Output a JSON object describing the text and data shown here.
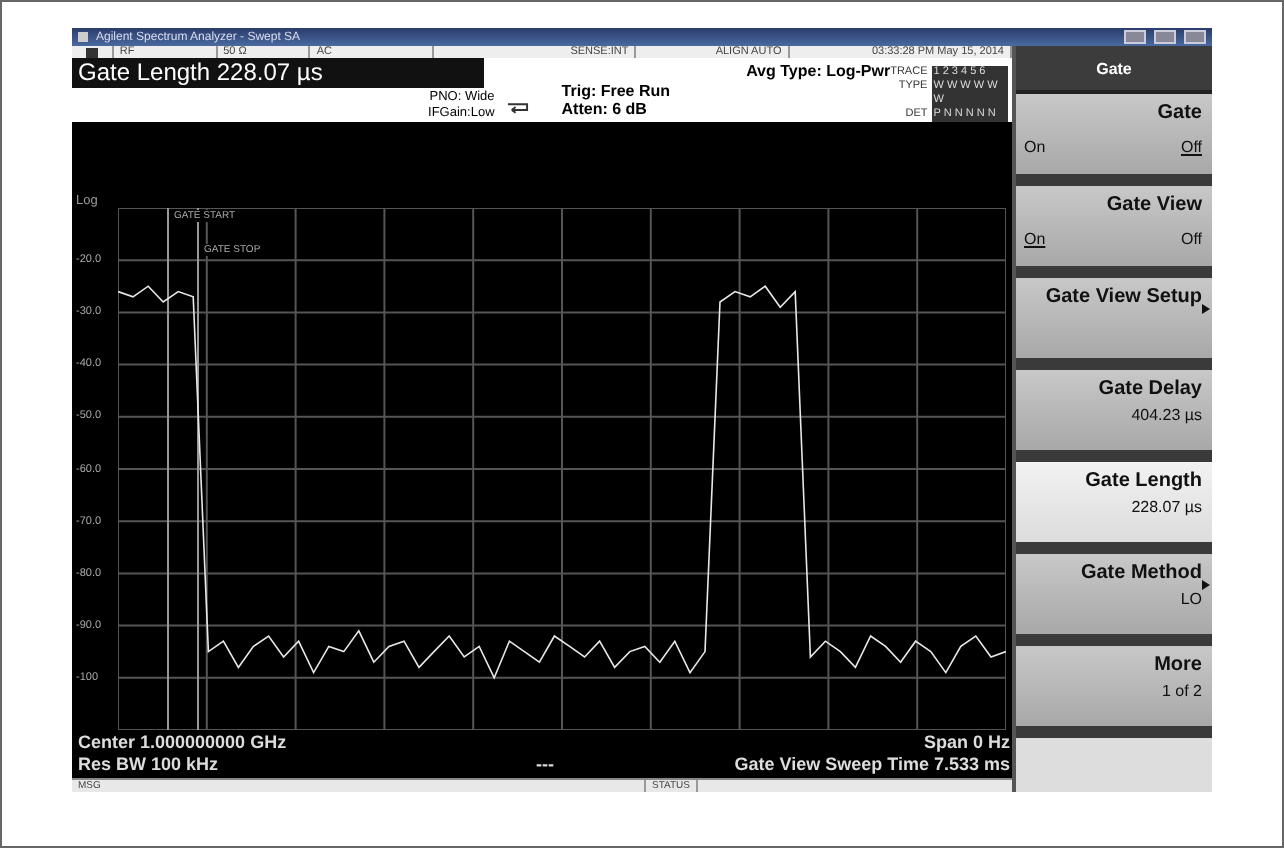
{
  "window": {
    "title": "Agilent Spectrum Analyzer - Swept SA"
  },
  "status_row": [
    "RF",
    "50 Ω",
    "AC",
    "SENSE:INT",
    "ALIGN AUTO",
    "03:33:28 PM May 15, 2014"
  ],
  "active_function": "Gate Length 228.07 µs",
  "settings": {
    "pno": "PNO: Wide",
    "ifgain": "IFGain:Low",
    "trig": "Trig: Free Run",
    "atten": "Atten: 6 dB",
    "avg_type": "Avg Type: Log-Pwr"
  },
  "trace_table": [
    {
      "label": "TRACE",
      "value": "1 2 3 4 5 6"
    },
    {
      "label": "TYPE",
      "value": "W W W W W W"
    },
    {
      "label": "DET",
      "value": "P N N N N N"
    }
  ],
  "graph": {
    "scale": "Log",
    "markers": [
      {
        "label": "GATE START"
      },
      {
        "label": "GATE STOP"
      }
    ],
    "chart_data": {
      "type": "line",
      "grid": true,
      "ylim": [
        -110,
        -10
      ],
      "yticks": [
        {
          "value": -20,
          "label": "-20.0"
        },
        {
          "value": -30,
          "label": "-30.0"
        },
        {
          "value": -40,
          "label": "-40.0"
        },
        {
          "value": -50,
          "label": "-50.0"
        },
        {
          "value": -60,
          "label": "-60.0"
        },
        {
          "value": -70,
          "label": "-70.0"
        },
        {
          "value": -80,
          "label": "-80.0"
        },
        {
          "value": -90,
          "label": "-90.0"
        },
        {
          "value": -100,
          "label": "-100"
        }
      ],
      "series": [
        {
          "color": "#e8e8e8",
          "values": [
            -26,
            -27,
            -25,
            -28,
            -26,
            -27,
            -95,
            -93,
            -98,
            -94,
            -92,
            -96,
            -93,
            -99,
            -94,
            -95,
            -91,
            -97,
            -94,
            -93,
            -98,
            -95,
            -92,
            -96,
            -94,
            -100,
            -93,
            -95,
            -97,
            -92,
            -94,
            -96,
            -93,
            -98,
            -95,
            -94,
            -97,
            -93,
            -99,
            -95,
            -28,
            -26,
            -27,
            -25,
            -29,
            -26,
            -96,
            -93,
            -95,
            -98,
            -92,
            -94,
            -97,
            -93,
            -95,
            -99,
            -94,
            -92,
            -96,
            -95
          ]
        }
      ]
    }
  },
  "footer": {
    "center": "Center 1.000000000 GHz",
    "span": "Span 0 Hz",
    "res_bw": "Res BW 100 kHz",
    "middle": "---",
    "sweep": "Gate View Sweep Time  7.533 ms"
  },
  "message_bar": {
    "msg": "MSG",
    "status": "STATUS"
  },
  "softkeys": {
    "title": "Gate",
    "keys": [
      {
        "kind": "toggle",
        "label": "Gate",
        "options": [
          {
            "label": "On",
            "selected": false
          },
          {
            "label": "Off",
            "selected": true
          }
        ],
        "selected": false
      },
      {
        "kind": "toggle",
        "label": "Gate View",
        "options": [
          {
            "label": "On",
            "selected": true
          },
          {
            "label": "Off",
            "selected": false
          }
        ],
        "selected": false
      },
      {
        "kind": "submenu",
        "label": "Gate View Setup",
        "selected": false
      },
      {
        "kind": "value",
        "label": "Gate Delay",
        "value": "404.23 µs",
        "selected": false
      },
      {
        "kind": "value",
        "label": "Gate Length",
        "value": "228.07 µs",
        "selected": true
      },
      {
        "kind": "submenu",
        "label": "Gate Method",
        "value": "LO",
        "selected": false
      },
      {
        "kind": "value",
        "label": "More",
        "value": "1 of 2",
        "selected": false
      }
    ]
  }
}
